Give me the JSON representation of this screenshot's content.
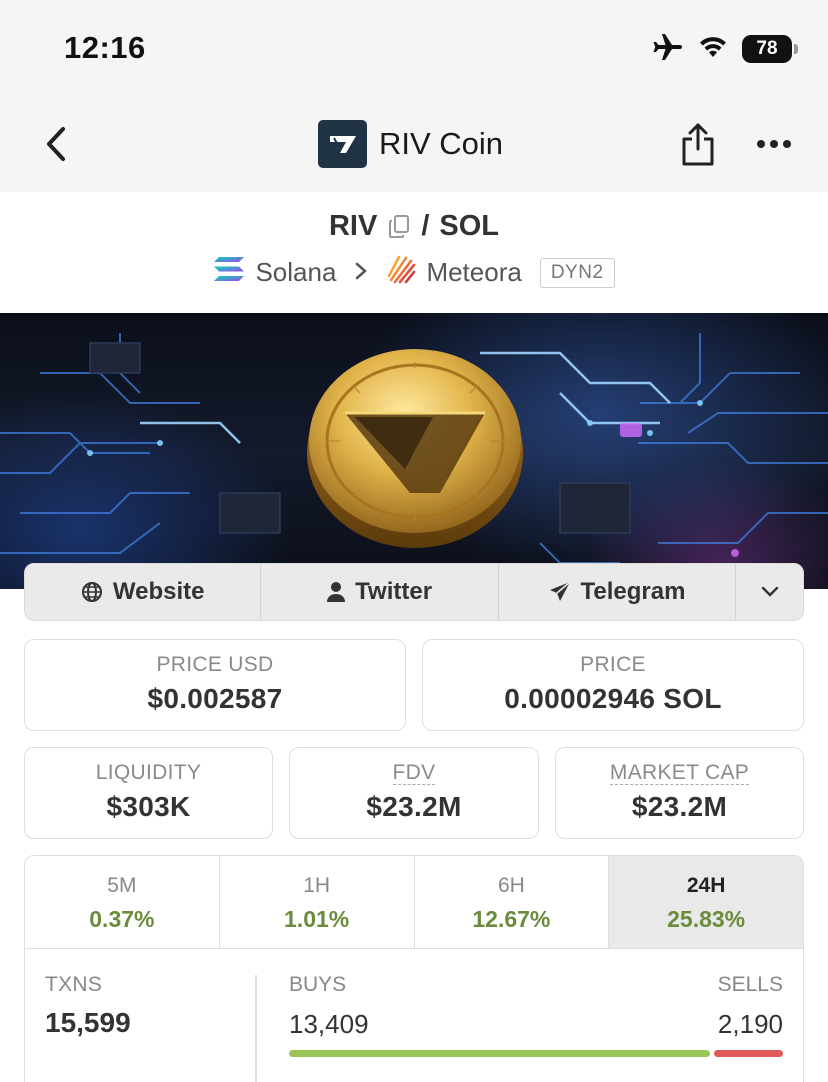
{
  "status_bar": {
    "time": "12:16",
    "battery": "78"
  },
  "nav": {
    "title": "RIV Coin"
  },
  "pair": {
    "base": "RIV",
    "quote": "SOL",
    "separator": "/",
    "chain": "Solana",
    "dex": "Meteora",
    "dex_badge": "DYN2"
  },
  "links": [
    {
      "label": "Website",
      "icon": "globe-icon"
    },
    {
      "label": "Twitter",
      "icon": "user-icon"
    },
    {
      "label": "Telegram",
      "icon": "paper-plane-icon"
    }
  ],
  "stats": {
    "price_usd": {
      "label": "PRICE USD",
      "value": "$0.002587"
    },
    "price": {
      "label": "PRICE",
      "value": "0.00002946 SOL"
    },
    "liquidity": {
      "label": "LIQUIDITY",
      "value": "$303K"
    },
    "fdv": {
      "label": "FDV",
      "value": "$23.2M"
    },
    "market_cap": {
      "label": "MARKET CAP",
      "value": "$23.2M"
    }
  },
  "timeframes": [
    {
      "label": "5M",
      "change": "0.37%"
    },
    {
      "label": "1H",
      "change": "1.01%"
    },
    {
      "label": "6H",
      "change": "12.67%"
    },
    {
      "label": "24H",
      "change": "25.83%",
      "active": true
    }
  ],
  "txns": {
    "label": "TXNS",
    "value": "15,599",
    "buys_label": "BUYS",
    "buys": "13,409",
    "sells_label": "SELLS",
    "sells": "2,190",
    "buy_share": 0.86
  },
  "colors": {
    "positive": "#6a8c3c",
    "buy_bar": "#9ac457",
    "sell_bar": "#e05a5a",
    "nav_logo_bg": "#1f3246"
  }
}
